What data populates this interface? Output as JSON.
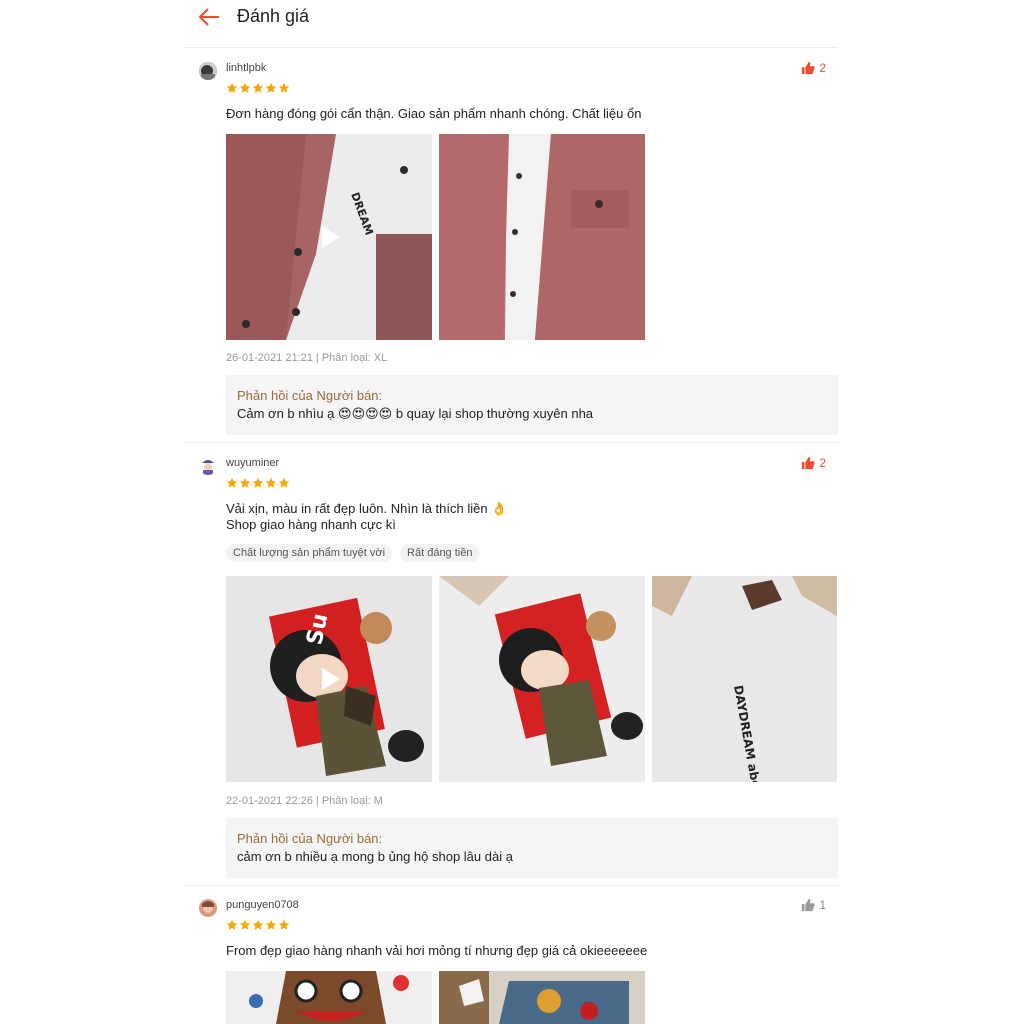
{
  "header": {
    "title": "Đánh giá"
  },
  "colors": {
    "accent": "#ee4d2d",
    "star": "#f6a700",
    "reply_label": "#9a6a3a"
  },
  "reviews": [
    {
      "username": "linhtlpbk",
      "likes": "2",
      "liked": true,
      "rating": 5,
      "comment_lines": [
        "Đơn hàng đóng gói cẩn thận. Giao sản phẩm nhanh chóng. Chất liệu ổn"
      ],
      "tags": [],
      "meta": "26-01-2021 21:21 | Phân loại: XL",
      "reply_label": "Phản hồi của Người bán:",
      "reply_text": "Cảm ơn b nhìu ạ 😍😍😍😍 b quay lại shop thường xuyên nha"
    },
    {
      "username": "wuyuminer",
      "likes": "2",
      "liked": true,
      "rating": 5,
      "comment_lines": [
        "Vải xịn, màu in rất đẹp luôn. Nhìn là thích liền 👌",
        "Shop giao hàng nhanh cực kì"
      ],
      "tags": [
        "Chất lượng sản phẩm tuyệt vời",
        "Rất đáng tiền"
      ],
      "meta": "22-01-2021 22:26 | Phân loại: M",
      "reply_label": "Phản hồi của Người bán:",
      "reply_text": "cảm ơn b nhiều ạ mong b ủng hộ shop lâu dài ạ"
    },
    {
      "username": "punguyen0708",
      "likes": "1",
      "liked": false,
      "rating": 5,
      "comment_lines": [
        "From đẹp giao hàng nhanh vải hơi mỏng tí nhưng đẹp giá cả okieeeeeee"
      ],
      "tags": [],
      "meta": "",
      "reply_label": "",
      "reply_text": ""
    }
  ],
  "images": {
    "shirt_back_text": "DAYDREAM about YOU"
  }
}
